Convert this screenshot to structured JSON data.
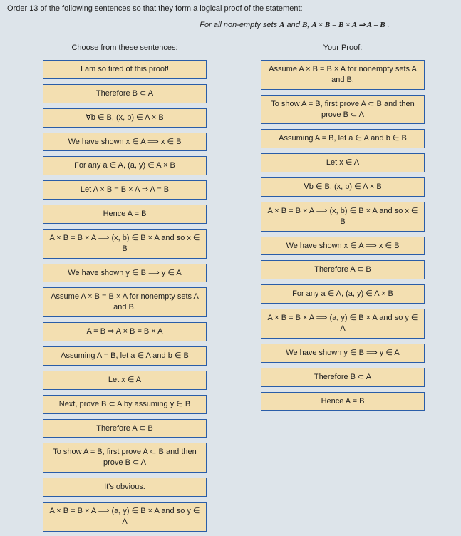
{
  "instruction": "Order 13 of the following sentences so that they form a logical proof of the statement:",
  "statement_prefix": "For all non-empty sets ",
  "statement_A": "A",
  "statement_and1": " and ",
  "statement_B": "B",
  "statement_mid": ", ",
  "statement_eq": "A × B = B × A ⇒ A = B",
  "statement_end": " .",
  "left_header": "Choose from these sentences:",
  "right_header": "Your Proof:",
  "left": [
    "I am so tired of this proof!",
    "Therefore B ⊂ A",
    "∀b ∈ B, (x, b) ∈ A × B",
    "We have shown x ∈ A  ⟹  x ∈ B",
    "For any a ∈ A, (a, y) ∈ A × B",
    "Let A × B = B × A ⇒ A = B",
    "Hence A = B",
    "A × B = B × A  ⟹  (x, b) ∈ B × A and so x ∈ B",
    "We have shown y ∈ B  ⟹  y ∈ A",
    "Assume A × B = B × A for nonempty sets A and B.",
    "A = B ⇒ A × B = B × A",
    "Assuming A = B, let a ∈ A and b ∈ B",
    "Let x ∈ A",
    "Next, prove B ⊂ A by assuming y ∈ B",
    "Therefore A ⊂ B",
    "To show A = B, first prove A ⊂ B and then prove B ⊂ A",
    "It's obvious.",
    "A × B = B × A  ⟹  (a, y) ∈ B × A and so y ∈ A"
  ],
  "right": [
    "Assume A × B = B × A for nonempty sets A and B.",
    "To show A = B, first prove A ⊂ B and then prove B ⊂ A",
    "Assuming A = B, let a ∈ A and b ∈ B",
    "Let x ∈ A",
    "∀b ∈ B, (x, b) ∈ A × B",
    "A × B = B × A  ⟹  (x, b) ∈ B × A and so x ∈ B",
    "We have shown x ∈ A  ⟹  x ∈ B",
    "Therefore A ⊂ B",
    "For any a ∈ A, (a, y) ∈ A × B",
    "A × B = B × A  ⟹  (a, y) ∈ B × A and so y ∈ A",
    "We have shown y ∈ B  ⟹  y ∈ A",
    "Therefore B ⊂ A",
    "Hence A = B"
  ]
}
